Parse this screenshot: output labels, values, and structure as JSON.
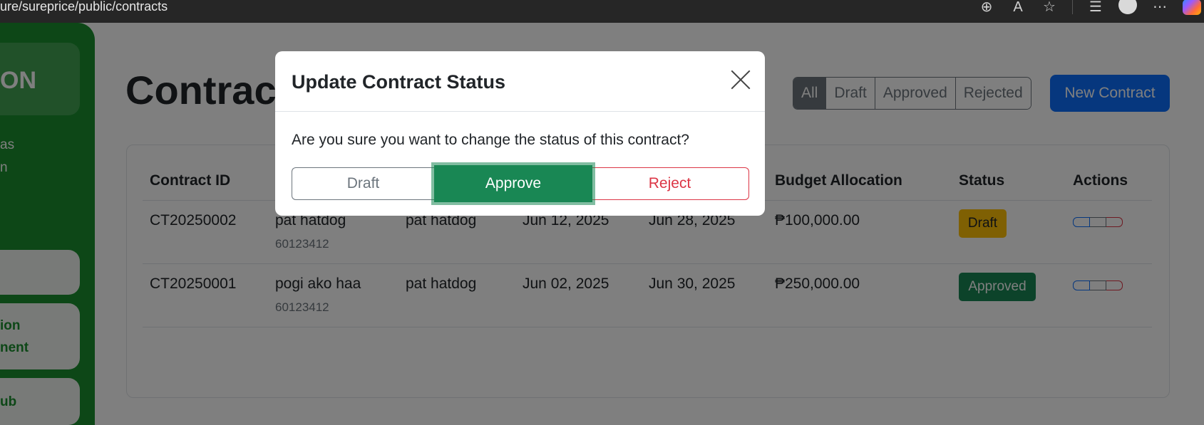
{
  "browser": {
    "url": "ure/sureprice/public/contracts",
    "icons": [
      "zoom-icon",
      "read-aloud-icon",
      "favorite-star-icon",
      "favorites-list-icon",
      "profile-avatar-icon",
      "more-icon",
      "copilot-icon"
    ]
  },
  "sidebar": {
    "brand": "ON",
    "text_lines": [
      "as",
      "n"
    ],
    "cards": [
      "",
      "ion",
      "nent",
      "ub"
    ]
  },
  "page": {
    "title": "Contract",
    "filters": [
      "All",
      "Draft",
      "Approved",
      "Rejected"
    ],
    "active_filter": "All",
    "new_button": "New Contract"
  },
  "table": {
    "headers": [
      "Contract ID",
      "",
      "",
      "",
      "",
      "Budget Allocation",
      "Status",
      "Actions"
    ],
    "rows": [
      {
        "id": "CT20250002",
        "name": "pat hatdog",
        "sub": "60123412",
        "col3": "pat hatdog",
        "start": "Jun 12, 2025",
        "end": "Jun 28, 2025",
        "budget": "₱100,000.00",
        "status": "Draft"
      },
      {
        "id": "CT20250001",
        "name": "pogi ako haa",
        "sub": "60123412",
        "col3": "pat hatdog",
        "start": "Jun 02, 2025",
        "end": "Jun 30, 2025",
        "budget": "₱250,000.00",
        "status": "Approved"
      }
    ]
  },
  "modal": {
    "title": "Update Contract Status",
    "message": "Are you sure you want to change the status of this contract?",
    "buttons": {
      "draft": "Draft",
      "approve": "Approve",
      "reject": "Reject"
    },
    "close_icon": "close-icon"
  },
  "colors": {
    "sidebar": "#1a8f2e",
    "primary": "#0d6efd",
    "success": "#198754",
    "warning": "#ffc107",
    "danger": "#dc3545",
    "secondary": "#6c757d"
  }
}
